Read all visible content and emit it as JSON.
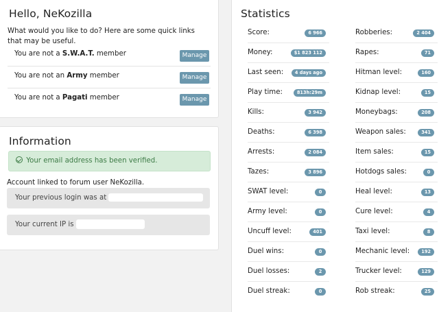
{
  "hello": {
    "title": "Hello, NeKozilla",
    "intro": "What would you like to do? Here are some quick links that may be useful.",
    "memberships": [
      {
        "prefix": "You are not a ",
        "group": "S.W.A.T.",
        "suffix": " member",
        "button": "Manage"
      },
      {
        "prefix": "You are not an ",
        "group": "Army",
        "suffix": " member",
        "button": "Manage"
      },
      {
        "prefix": "You are not a ",
        "group": "Pagati",
        "suffix": " member",
        "button": "Manage"
      }
    ]
  },
  "information": {
    "title": "Information",
    "verified": "Your email address has been verified.",
    "linked": "Account linked to forum user NeKozilla.",
    "previous_login": "Your previous login was at",
    "current_ip": "Your current IP is"
  },
  "statistics": {
    "title": "Statistics",
    "left": [
      {
        "label": "Score:",
        "value": "6 966"
      },
      {
        "label": "Money:",
        "value": "$1 823 112"
      },
      {
        "label": "Last seen:",
        "value": "4 days ago"
      },
      {
        "label": "Play time:",
        "value": "813h:29m"
      },
      {
        "label": "Kills:",
        "value": "3 942"
      },
      {
        "label": "Deaths:",
        "value": "6 398"
      },
      {
        "label": "Arrests:",
        "value": "2 084"
      },
      {
        "label": "Tazes:",
        "value": "3 896"
      },
      {
        "label": "SWAT level:",
        "value": "0"
      },
      {
        "label": "Army level:",
        "value": "0"
      },
      {
        "label": "Uncuff level:",
        "value": "401"
      },
      {
        "label": "Duel wins:",
        "value": "0"
      },
      {
        "label": "Duel losses:",
        "value": "2"
      },
      {
        "label": "Duel streak:",
        "value": "0"
      }
    ],
    "right": [
      {
        "label": "Robberies:",
        "value": "2 404"
      },
      {
        "label": "Rapes:",
        "value": "71"
      },
      {
        "label": "Hitman level:",
        "value": "160"
      },
      {
        "label": "Kidnap level:",
        "value": "15"
      },
      {
        "label": "Moneybags:",
        "value": "208"
      },
      {
        "label": "Weapon sales:",
        "value": "341"
      },
      {
        "label": "Item sales:",
        "value": "15"
      },
      {
        "label": "Hotdogs sales:",
        "value": "0"
      },
      {
        "label": "Heal level:",
        "value": "13"
      },
      {
        "label": "Cure level:",
        "value": "4"
      },
      {
        "label": "Taxi level:",
        "value": "8"
      },
      {
        "label": "Mechanic level:",
        "value": "192"
      },
      {
        "label": "Trucker level:",
        "value": "129"
      },
      {
        "label": "Rob streak:",
        "value": "25"
      }
    ]
  }
}
